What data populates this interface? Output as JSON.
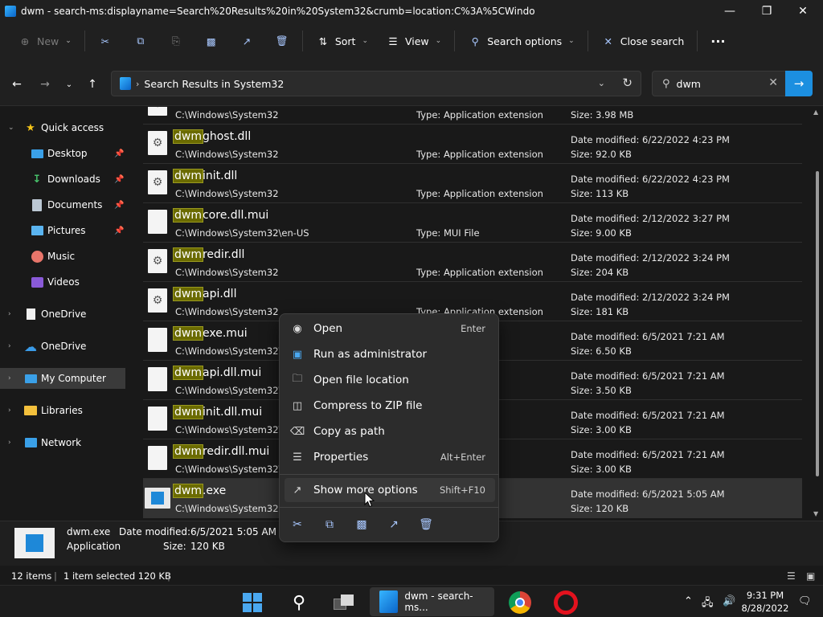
{
  "window": {
    "title": "dwm - search-ms:displayname=Search%20Results%20in%20System32&crumb=location:C%3A%5CWindows%5CSy"
  },
  "toolbar": {
    "new_label": "New",
    "sort_label": "Sort",
    "view_label": "View",
    "search_options_label": "Search options",
    "close_search_label": "Close search",
    "more_label": "···"
  },
  "address": {
    "breadcrumb": "Search Results in System32"
  },
  "search": {
    "value": "dwm"
  },
  "nav": {
    "quick_access": "Quick access",
    "desktop": "Desktop",
    "downloads": "Downloads",
    "documents": "Documents",
    "pictures": "Pictures",
    "music": "Music",
    "videos": "Videos",
    "onedrive1": "OneDrive",
    "onedrive2": "OneDrive",
    "my_computer": "My Computer",
    "libraries": "Libraries",
    "network": "Network"
  },
  "files": [
    {
      "hl": "",
      "rest": "",
      "path": "C:\\Windows\\System32",
      "type": "Type: Application extension",
      "date": "",
      "size": "Size: 3.98 MB"
    },
    {
      "hl": "dwm",
      "rest": "ghost.dll",
      "path": "C:\\Windows\\System32",
      "type": "Type: Application extension",
      "date": "Date modified: 6/22/2022 4:23 PM",
      "size": "Size: 92.0 KB"
    },
    {
      "hl": "dwm",
      "rest": "init.dll",
      "path": "C:\\Windows\\System32",
      "type": "Type: Application extension",
      "date": "Date modified: 6/22/2022 4:23 PM",
      "size": "Size: 113 KB"
    },
    {
      "hl": "dwm",
      "rest": "core.dll.mui",
      "path": "C:\\Windows\\System32\\en-US",
      "type": "Type: MUI File",
      "date": "Date modified: 2/12/2022 3:27 PM",
      "size": "Size: 9.00 KB"
    },
    {
      "hl": "dwm",
      "rest": "redir.dll",
      "path": "C:\\Windows\\System32",
      "type": "Type: Application extension",
      "date": "Date modified: 2/12/2022 3:24 PM",
      "size": "Size: 204 KB"
    },
    {
      "hl": "dwm",
      "rest": "api.dll",
      "path": "C:\\Windows\\System32",
      "type": "Type: Application extension",
      "date": "Date modified: 2/12/2022 3:24 PM",
      "size": "Size: 181 KB"
    },
    {
      "hl": "dwm",
      "rest": "exe.mui",
      "path": "C:\\Windows\\System32\\e",
      "type": "",
      "date": "Date modified: 6/5/2021 7:21 AM",
      "size": "Size: 6.50 KB"
    },
    {
      "hl": "dwm",
      "rest": "api.dll.mui",
      "path": "C:\\Windows\\System32\\e",
      "type": "",
      "date": "Date modified: 6/5/2021 7:21 AM",
      "size": "Size: 3.50 KB"
    },
    {
      "hl": "dwm",
      "rest": "init.dll.mui",
      "path": "C:\\Windows\\System32\\e",
      "type": "",
      "date": "Date modified: 6/5/2021 7:21 AM",
      "size": "Size: 3.00 KB"
    },
    {
      "hl": "dwm",
      "rest": "redir.dll.mui",
      "path": "C:\\Windows\\System32\\e",
      "type": "",
      "date": "Date modified: 6/5/2021 7:21 AM",
      "size": "Size: 3.00 KB"
    },
    {
      "hl": "dwm",
      "rest": ".exe",
      "path": "C:\\Windows\\System32",
      "type": "",
      "date": "Date modified: 6/5/2021 5:05 AM",
      "size": "Size: 120 KB"
    }
  ],
  "details": {
    "name": "dwm.exe",
    "kind": "Application",
    "date_label": "Date modified:",
    "date_value": "6/5/2021 5:05 AM",
    "size_label": "Size:",
    "size_value": "120 KB"
  },
  "status": {
    "items": "12 items",
    "selected": "1 item selected  120 KB"
  },
  "context_menu": {
    "open": "Open",
    "open_key": "Enter",
    "run_admin": "Run as administrator",
    "open_location": "Open file location",
    "compress": "Compress to ZIP file",
    "copy_path": "Copy as path",
    "properties": "Properties",
    "properties_key": "Alt+Enter",
    "more_options": "Show more options",
    "more_options_key": "Shift+F10"
  },
  "taskbar": {
    "active_label": "dwm - search-ms...",
    "time": "9:31 PM",
    "date": "8/28/2022"
  },
  "colors": {
    "accent": "#1c8fe0",
    "highlight": "#6b6b00"
  }
}
